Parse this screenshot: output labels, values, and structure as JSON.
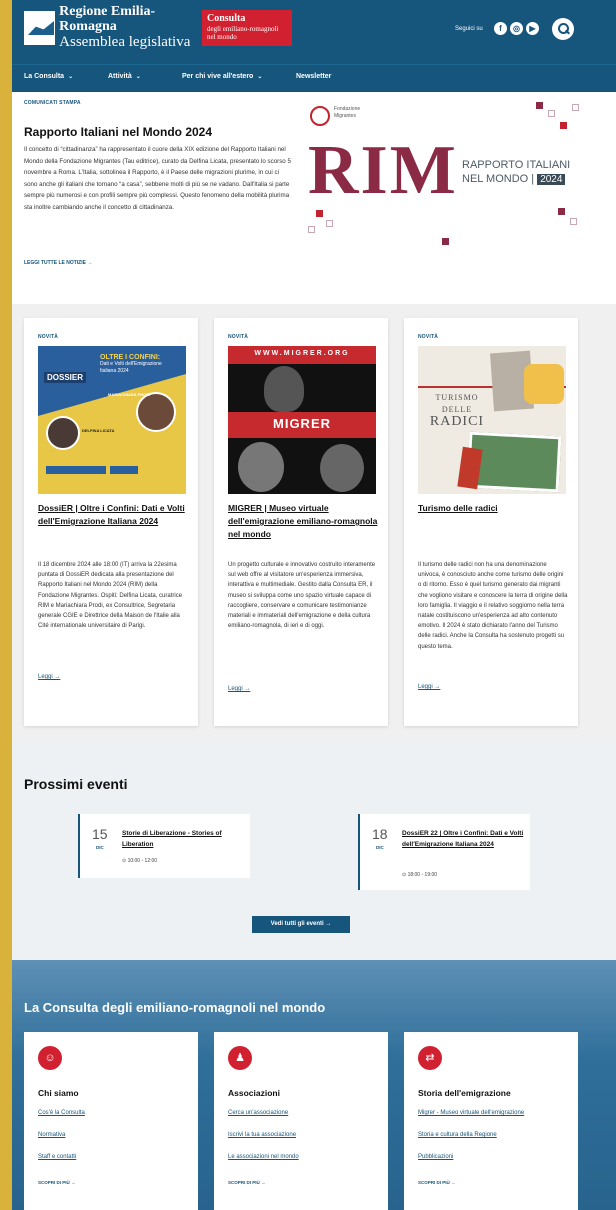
{
  "header": {
    "logo_line1": "Regione Emilia-Romagna",
    "logo_line2": "Assemblea legislativa",
    "badge_line1": "Consulta",
    "badge_line2": "degli emiliano-romagnoli",
    "badge_line3": "nel mondo",
    "follow_label": "Seguici su",
    "social": [
      "facebook-icon",
      "instagram-icon",
      "youtube-icon"
    ]
  },
  "nav": {
    "items": [
      {
        "label": "La Consulta",
        "has_menu": true
      },
      {
        "label": "Attività",
        "has_menu": true
      },
      {
        "label": "Per chi vive all'estero",
        "has_menu": true
      },
      {
        "label": "Newsletter",
        "has_menu": false
      }
    ],
    "chevron": "⌄"
  },
  "news": {
    "kicker": "COMUNICATI STAMPA",
    "title": "Rapporto Italiani nel Mondo 2024",
    "body": "Il concetto di “cittadinanza” ha rappresentato il cuore della XIX edizione del Rapporto Italiani nel Mondo della Fondazione Migrantes (Tau editrice), curato da Delfina Licata, presentato lo scorso 5 novembre a Roma. L'Italia, sottolinea il Rapporto, è il Paese delle migrazioni plurime, in cui ci sono anche gli italiani che tornano “a casa”, sebbene molti di più se ne vadano. Dall'Italia si parte sempre più numerosi e con profili sempre più complessi. Questo fenomeno della mobilità plurima sta inoltre cambiando anche il concetto di cittadinanza.",
    "link": "LEGGI TUTTE LE NOTIZIE →",
    "image": {
      "org_line1": "Fondazione",
      "org_line2": "Migrantes",
      "big": "RIM",
      "sub_line1": "RAPPORTO ITALIANI",
      "sub_line2": "NEL MONDO |",
      "year": "2024"
    }
  },
  "cards": [
    {
      "kicker": "NOVITÀ",
      "title": "DossiER | Oltre i Confini: Dati e Volti dell'Emigrazione Italiana 2024",
      "text": "Il 18 dicembre 2024 alle 18:00 (IT) arriva la 22esima puntata di DossiER dedicata alla presentazione del Rapporto Italiani nel Mondo 2024 (RIM) della Fondazione Migrantes. Ospiti: Delfina Licata, curatrice RIM e Mariachiara Prodi, ex Consultrice, Segretaria generale CGIE e Direttrice della Maison de l'Italie alla Cité internationale universitaire di Parigi.",
      "more": "Leggi →",
      "thumb": {
        "logo": "DOSSIER",
        "heading_line1": "OLTRE I CONFINI:",
        "heading_line2": "Dati e Volti dell'Emigrazione",
        "heading_line3": "Italiana 2024",
        "person_a": "DELFINA LICATA",
        "person_b": "MARIACHIARA PRODI"
      }
    },
    {
      "kicker": "NOVITÀ",
      "title": "MIGRER | Museo virtuale dell'emigrazione emiliano-romagnola nel mondo",
      "text": "Un progetto culturale e innovativo costruito interamente sul web offre al visitatore un'esperienza immersiva, interattiva e multimediale. Gestito dalla Consulta ER, il museo si sviluppa come uno spazio virtuale capace di raccogliere, conservare e comunicare testimonianze materiali e immateriali dell'emigrazione e della cultura emiliano-romagnola, di ieri e di oggi.",
      "more": "Leggi →",
      "thumb": {
        "site": "WWW.MIGRER.ORG",
        "logo": "MIGRER"
      }
    },
    {
      "kicker": "NOVITÀ",
      "title": "Turismo delle radici",
      "text": "Il turismo delle radici non ha una denominazione univoca, è conosciuto anche come turismo delle origini o di ritorno. Esso è quel turismo generato dai migranti che vogliono visitare e conoscere la terra di origine della loro famiglia. Il viaggio e il relativo soggiorno nella terra natale costituiscono un'esperienza ad alto contenuto emotivo. Il 2024 è stato dichiarato l'anno del Turismo delle radici. Anche la Consulta ha sostenuto progetti su questo tema.",
      "more": "Leggi →",
      "thumb": {
        "line1": "TURISMO",
        "line2": "DELLE",
        "line3": "RADICI"
      }
    }
  ],
  "events": {
    "title": "Prossimi eventi",
    "items": [
      {
        "day": "15",
        "month": "DIC",
        "title": "Storie di Liberazione - Stories of Liberation",
        "time": "⊙ 10:00 - 12:00"
      },
      {
        "day": "18",
        "month": "DIC",
        "title": "DossiER 22 | Oltre i Confini: Dati e Volti dell'Emigrazione Italiana 2024",
        "time": "⊙ 18:00 - 19:00"
      }
    ],
    "button": "Vedi tutti gli eventi →"
  },
  "consulta": {
    "title": "La Consulta degli emiliano-romagnoli nel mondo",
    "cards": [
      {
        "icon": "people-icon",
        "glyph": "☺",
        "heading": "Chi siamo",
        "links": [
          "Cos'è la Consulta",
          "Normativa",
          "Staff e contatti"
        ],
        "discover": "SCOPRI DI PIÙ →"
      },
      {
        "icon": "associations-icon",
        "glyph": "♟",
        "heading": "Associazioni",
        "links": [
          "Cerca un'associazione",
          "Iscrivi la tua associazione",
          "Le associazioni nel mondo"
        ],
        "discover": "SCOPRI DI PIÙ →"
      },
      {
        "icon": "emigration-icon",
        "glyph": "⇄",
        "heading": "Storia dell'emigrazione",
        "links": [
          "Migrer - Museo virtuale dell'emigrazione",
          "Storia e cultura della Regione",
          "Pubblicazioni"
        ],
        "discover": "SCOPRI DI PIÙ →"
      }
    ]
  },
  "colors": {
    "brand_blue": "#16557c",
    "accent_red": "#d1202f",
    "frame_yellow": "#d9b23c"
  }
}
